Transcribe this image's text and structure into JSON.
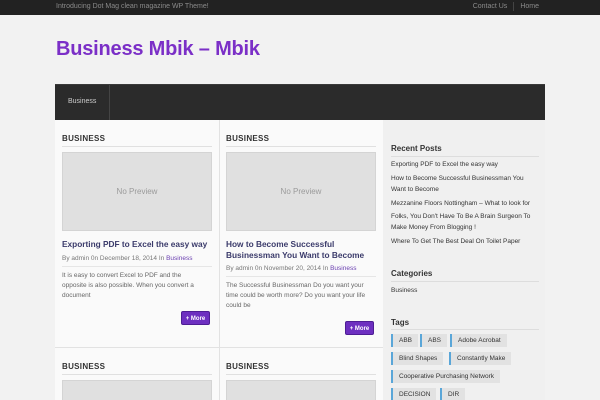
{
  "topbar": {
    "tagline": "Introducing Dot Mag clean magazine WP Theme!",
    "links": [
      "Contact Us",
      "Home"
    ]
  },
  "site": {
    "title": "Business Mbik – Mbik"
  },
  "nav": {
    "items": [
      "Business"
    ]
  },
  "posts": [
    {
      "category": "BUSINESS",
      "preview": "No Preview",
      "title": "Exporting PDF to Excel the easy way",
      "meta_prefix": "By admin 0n December 18, 2014 In",
      "meta_category": "Business",
      "excerpt": "It is easy to convert Excel to PDF and the opposite is also possible. When you convert a document",
      "more": "+ More"
    },
    {
      "category": "BUSINESS",
      "preview": "No Preview",
      "title": "How to Become Successful Businessman You Want to Become",
      "meta_prefix": "By admin 0n November 20, 2014 In",
      "meta_category": "Business",
      "excerpt": "The Successful Businessman Do you want your time could be worth more? Do you want your life could be",
      "more": "+ More"
    },
    {
      "category": "BUSINESS"
    },
    {
      "category": "BUSINESS"
    }
  ],
  "sidebar": {
    "recent_title": "Recent Posts",
    "recent_posts": [
      "Exporting PDF to Excel the easy way",
      "How to Become Successful Businessman You Want to Become",
      "Mezzanine Floors Nottingham – What to look for",
      "Folks, You Don't Have To Be A Brain Surgeon To Make Money From Blogging !",
      "Where To Get The Best Deal On Toilet Paper"
    ],
    "categories_title": "Categories",
    "categories": [
      "Business"
    ],
    "tags_title": "Tags",
    "tags": [
      "ABB",
      "ABS",
      "Adobe Acrobat",
      "Blind Shapes",
      "Constantly Make",
      "Cooperative Purchasing Network",
      "DECISION",
      "DIR"
    ],
    "tag_accent": "#5aa6d8"
  },
  "colors": {
    "brand": "#7b2fc7",
    "button": "#6d2fc0",
    "navbar": "#2b2b2b"
  }
}
